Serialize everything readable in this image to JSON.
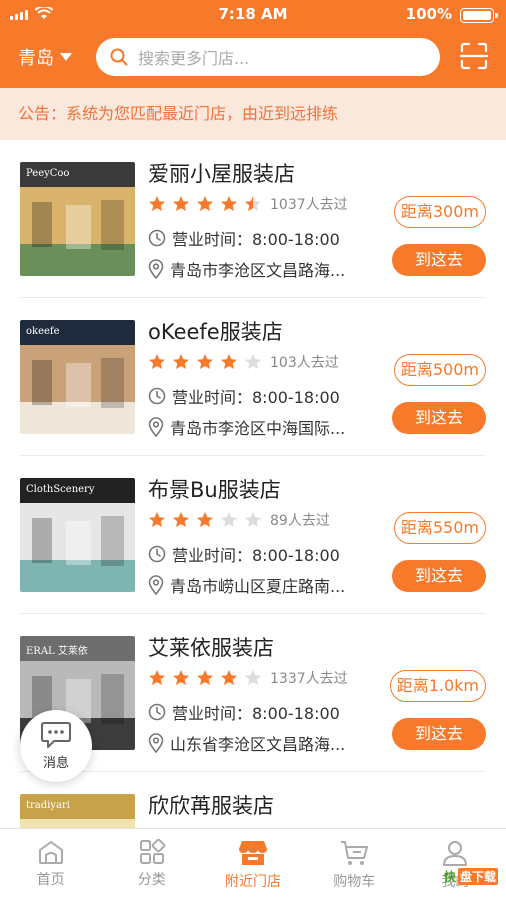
{
  "status_bar": {
    "time": "7:18 AM",
    "battery": "100%"
  },
  "header": {
    "city": "青岛",
    "search_placeholder": "搜索更多门店..."
  },
  "notice": "公告：系统为您匹配最近门店，由近到远排练",
  "stores": [
    {
      "name": "爱丽小屋服装店",
      "rating": 4.5,
      "visits": "1037人去过",
      "hours": "营业时间：8:00-18:00",
      "address": "青岛市李沧区文昌路海...",
      "distance": "距离300m",
      "go_label": "到这去",
      "sign": "PeeyCoo",
      "palette": [
        "#3a3a3a",
        "#d9b36b",
        "#6b8f5a"
      ]
    },
    {
      "name": "oKeefe服装店",
      "rating": 4,
      "visits": "103人去过",
      "hours": "营业时间：8:00-18:00",
      "address": "青岛市李沧区中海国际...",
      "distance": "距离500m",
      "go_label": "到这去",
      "sign": "okeefe",
      "palette": [
        "#1f2a3c",
        "#c9a27a",
        "#efe6da"
      ]
    },
    {
      "name": "布景Bu服装店",
      "rating": 3,
      "visits": "89人去过",
      "hours": "营业时间：8:00-18:00",
      "address": "青岛市崂山区夏庄路南...",
      "distance": "距离550m",
      "go_label": "到这去",
      "sign": "ClothScenery",
      "palette": [
        "#222",
        "#e6e6e6",
        "#7fb5b0"
      ]
    },
    {
      "name": "艾莱依服装店",
      "rating": 4,
      "visits": "1337人去过",
      "hours": "营业时间：8:00-18:00",
      "address": "山东省李沧区文昌路海...",
      "distance": "距离1.0km",
      "go_label": "到这去",
      "sign": "ERAL 艾莱依",
      "palette": [
        "#6d6d6d",
        "#b9b9b9",
        "#3c3c3c"
      ]
    },
    {
      "name": "欣欣苒服装店",
      "rating": 0,
      "visits": "",
      "hours": "",
      "address": "",
      "distance": "",
      "go_label": "",
      "sign": "tradiyari",
      "palette": [
        "#c8a24a",
        "#f1e3b0",
        "#8a6a20"
      ]
    }
  ],
  "floating": {
    "message_label": "消息"
  },
  "tabs": [
    {
      "label": "首页",
      "icon": "home-icon"
    },
    {
      "label": "分类",
      "icon": "category-icon"
    },
    {
      "label": "附近门店",
      "icon": "shop-icon",
      "active": true
    },
    {
      "label": "购物车",
      "icon": "cart-icon"
    },
    {
      "label": "我的",
      "icon": "user-icon"
    }
  ],
  "watermark": {
    "a": "快",
    "b": "盘下载"
  },
  "colors": {
    "accent": "#f7792a",
    "star": "#f7792a",
    "star_empty": "#dddddd",
    "notice_bg": "#fbe8dd"
  }
}
